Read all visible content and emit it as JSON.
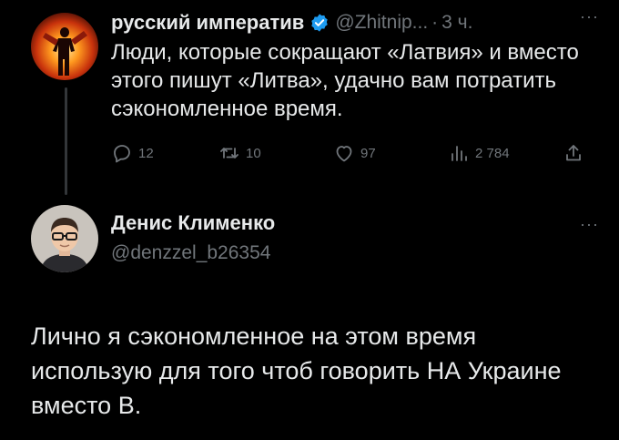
{
  "post": {
    "author_name": "русский императив",
    "handle": "@Zhitnip...",
    "separator": "·",
    "time": "3 ч.",
    "more": "···",
    "text": "Люди, которые сокращают «Латвия» и вместо этого пишут «Литва», удачно вам потратить сэкономленное время.",
    "actions": {
      "reply_count": "12",
      "retweet_count": "10",
      "like_count": "97",
      "views_count": "2 784"
    },
    "icons": [
      "reply-icon",
      "retweet-icon",
      "like-icon",
      "views-icon",
      "share-icon",
      "verified-badge-icon"
    ]
  },
  "reply": {
    "author_name": "Денис Клименко",
    "handle": "@denzzel_b26354",
    "more": "···",
    "text": "Лично я сэкономленное на этом время использую для того чтоб говорить НА Украине вместо В."
  },
  "colors": {
    "background": "#000000",
    "primary_text": "#e7e9ea",
    "secondary_text": "#71767b",
    "verified": "#1d9bf0",
    "thread_line": "#333639"
  }
}
